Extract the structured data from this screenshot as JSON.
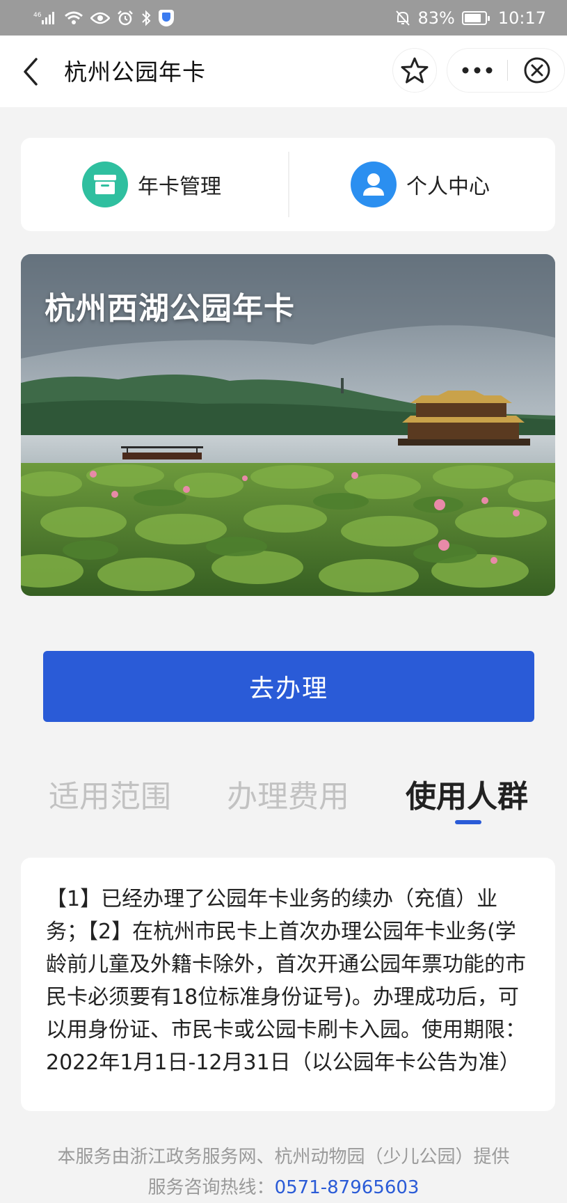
{
  "status_bar": {
    "network": "⁴⁶",
    "battery": "83%",
    "battery_level": 0.83,
    "time": "10:17"
  },
  "header": {
    "title": "杭州公园年卡"
  },
  "quick_nav": [
    {
      "label": "年卡管理",
      "icon": "card-manage-icon",
      "color": "#2fbf9f"
    },
    {
      "label": "个人中心",
      "icon": "user-icon",
      "color": "#2b8ff0"
    }
  ],
  "banner": {
    "title": "杭州西湖公园年卡"
  },
  "action": {
    "label": "去办理"
  },
  "tabs": [
    {
      "label": "适用范围",
      "active": false
    },
    {
      "label": "办理费用",
      "active": false
    },
    {
      "label": "使用人群",
      "active": true
    }
  ],
  "content": {
    "text": "【1】已经办理了公园年卡业务的续办（充值）业务；【2】在杭州市民卡上首次办理公园年卡业务(学龄前儿童及外籍卡除外，首次开通公园年票功能的市民卡必须要有18位标准身份证号)。办理成功后，可以用身份证、市民卡或公园卡刷卡入园。使用期限：2022年1月1日-12月31日（以公园年卡公告为准）"
  },
  "footer": {
    "provider": "本服务由浙江政务服务网、杭州动物园（少儿公园）提供",
    "hotline_label": "服务咨询热线：",
    "hotline_number": "0571-87965603"
  },
  "colors": {
    "accent": "#2a5bd7",
    "status_bar": "#9b9b9b"
  }
}
